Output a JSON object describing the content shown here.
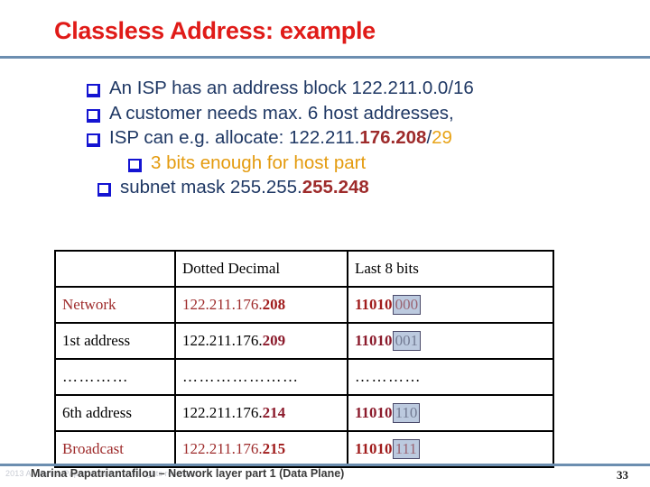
{
  "slide": {
    "title": "Classless Address: example",
    "page_number": "33",
    "accent_rule_color": "#6C8EB0",
    "title_color": "#E01B18"
  },
  "bullets": [
    {
      "marker": "square-bullet-icon",
      "level": 1,
      "segments": [
        {
          "text": "An ISP has an address block 122.211.0.0/16",
          "style": "navy"
        }
      ]
    },
    {
      "marker": "square-bullet-icon",
      "level": 1,
      "segments": [
        {
          "text": "A customer needs max. 6 host addresses,",
          "style": "navy"
        }
      ]
    },
    {
      "marker": "square-bullet-icon",
      "level": 1,
      "segments": [
        {
          "text": "ISP can e.g. allocate: 122.211.",
          "style": "navy"
        },
        {
          "text": "176.208",
          "style": "dark-red-bold"
        },
        {
          "text": "/",
          "style": "navy"
        },
        {
          "text": "29",
          "style": "gold"
        }
      ]
    },
    {
      "marker": "square-bullet-icon",
      "level": 2,
      "segments": [
        {
          "text": "3 bits enough for host part",
          "style": "gold-text"
        }
      ]
    },
    {
      "marker": "square-bullet-icon",
      "level": 1,
      "segments": [
        {
          "text": "subnet mask 255.255.",
          "style": "navy"
        },
        {
          "text": "255.248",
          "style": "dark-red-bold"
        }
      ]
    }
  ],
  "table": {
    "columns": [
      "",
      "Dotted Decimal",
      "Last 8 bits"
    ],
    "rows": [
      {
        "row_style": "header",
        "label": "",
        "dotted_decimal_prefix": "Dotted Decimal",
        "last8_prefix": "Last 8 bits",
        "last8_highlight": ""
      },
      {
        "row_style": "red",
        "label": "Network",
        "dotted_decimal_prefix": "122.211.176.",
        "dotted_decimal_bold": "208",
        "last8_prefix": "11010",
        "last8_highlight": "000"
      },
      {
        "row_style": "black",
        "label": "1st address",
        "dotted_decimal_prefix": "122.211.176.",
        "dotted_decimal_bold": "209",
        "last8_prefix": "11010",
        "last8_highlight": "001"
      },
      {
        "row_style": "black",
        "label": "…………",
        "dotted_decimal_prefix": "…………………",
        "dotted_decimal_bold": "",
        "last8_prefix": "…………",
        "last8_highlight": ""
      },
      {
        "row_style": "black",
        "label": "6th address",
        "dotted_decimal_prefix": "122.211.176.",
        "dotted_decimal_bold": "214",
        "last8_prefix": "11010",
        "last8_highlight": "110"
      },
      {
        "row_style": "red",
        "label": "Broadcast",
        "dotted_decimal_prefix": "122.211.176.",
        "dotted_decimal_bold": "215",
        "last8_prefix": "11010",
        "last8_highlight": "111"
      }
    ]
  },
  "footer": {
    "author_line": "Marina Papatriantafilou – Network layer part 1 (Data Plane)",
    "copyright_line": "2013 A. Marina Papatriantafilou – All rights reserved"
  }
}
